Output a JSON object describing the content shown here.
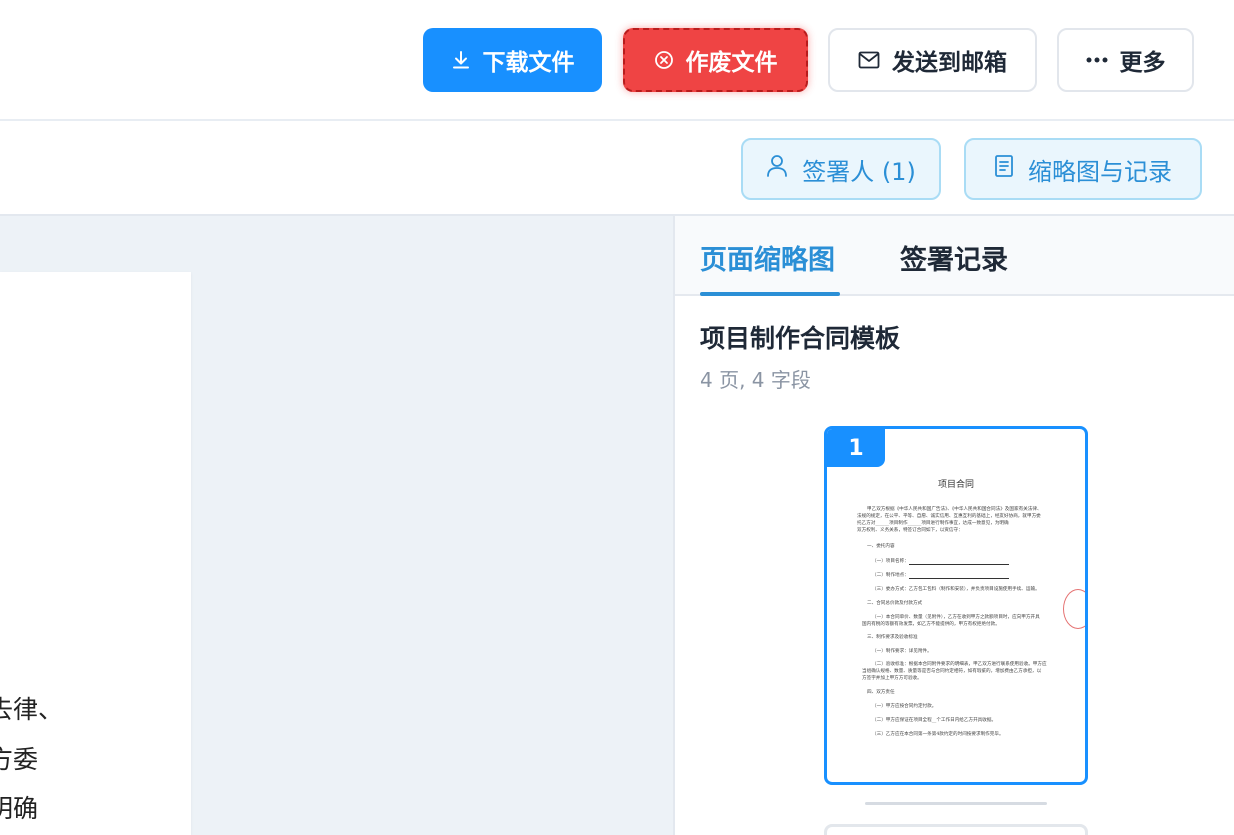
{
  "toolbar": {
    "download_label": "下载文件",
    "void_label": "作废文件",
    "email_label": "发送到邮箱",
    "more_label": "更多"
  },
  "subbar": {
    "signer_label": "签署人 (1)",
    "thumbs_label": "缩略图与记录"
  },
  "document": {
    "visible_lines": [
      "去律、",
      "方委",
      "明确"
    ]
  },
  "panel": {
    "tabs": [
      {
        "label": "页面缩略图",
        "active": true
      },
      {
        "label": "签署记录",
        "active": false
      }
    ],
    "template_title": "项目制作合同模板",
    "template_meta": "4 页, 4 字段",
    "thumbnails": [
      {
        "page": "1",
        "selected": true
      }
    ]
  },
  "mini_doc": {
    "title": "项目合同",
    "intro": [
      "甲乙双方根据《中华人民共和国广告法》、《中华人民共和国合同法》及国家有关法律、",
      "法规的规定，在公平、平等、自愿、诚实信用、互惠互利的基础上，经友好协商，就甲方委",
      "托乙方对______项目制作______项目进行制作事宜，达成一致意见，为明确",
      "双方权利、义务关系，特签订合同如下，以资信守："
    ],
    "s1": "一、委托内容",
    "s1_items": [
      "（一）项目名称：",
      "（二）制作地点：",
      "（三）委办方式：乙方包工包料（制作和安装），并负责项目设施使用手续、运输。"
    ],
    "s2": "二、合同总价款及付款方式",
    "s2_items": [
      "（一）本合同单价、数量（见附件），乙方在收到甲方之款额项目时，应向甲方开具",
      "国内有税的等额有效发票，如乙方不能提供的，甲方有权拒绝付款。"
    ],
    "s3": "三、制作要求及验收标准",
    "s3_items": [
      "（一）制作要求：详见附件。",
      "（二）验收标准：根据本合同附件要求的明细表，甲乙双方进行联系使用验收。甲方应",
      "当组确认规格、数量、质量等是否与合同约定相符，如有瑕疵的，增加费由乙方承担，以",
      "方签字并加上甲方方可验收。"
    ],
    "s4": "四、双方责任",
    "s4_items": [
      "（一）甲方应按合同约定付款。",
      "（二）甲方应保证在项目全程__个工作日内给乙方开具收据。",
      "（三）乙方应在本合同第一条第4款约定的时间按要求制作完毕。"
    ]
  },
  "colors": {
    "primary": "#1890ff",
    "danger": "#ef4444",
    "accent_text": "#2b8fd6",
    "workspace_bg": "#edf2f7"
  },
  "icons": {
    "download": "download-icon",
    "void": "circle-x-icon",
    "email": "mail-icon",
    "more": "ellipsis-icon",
    "signer": "user-icon",
    "thumbs": "document-list-icon"
  }
}
